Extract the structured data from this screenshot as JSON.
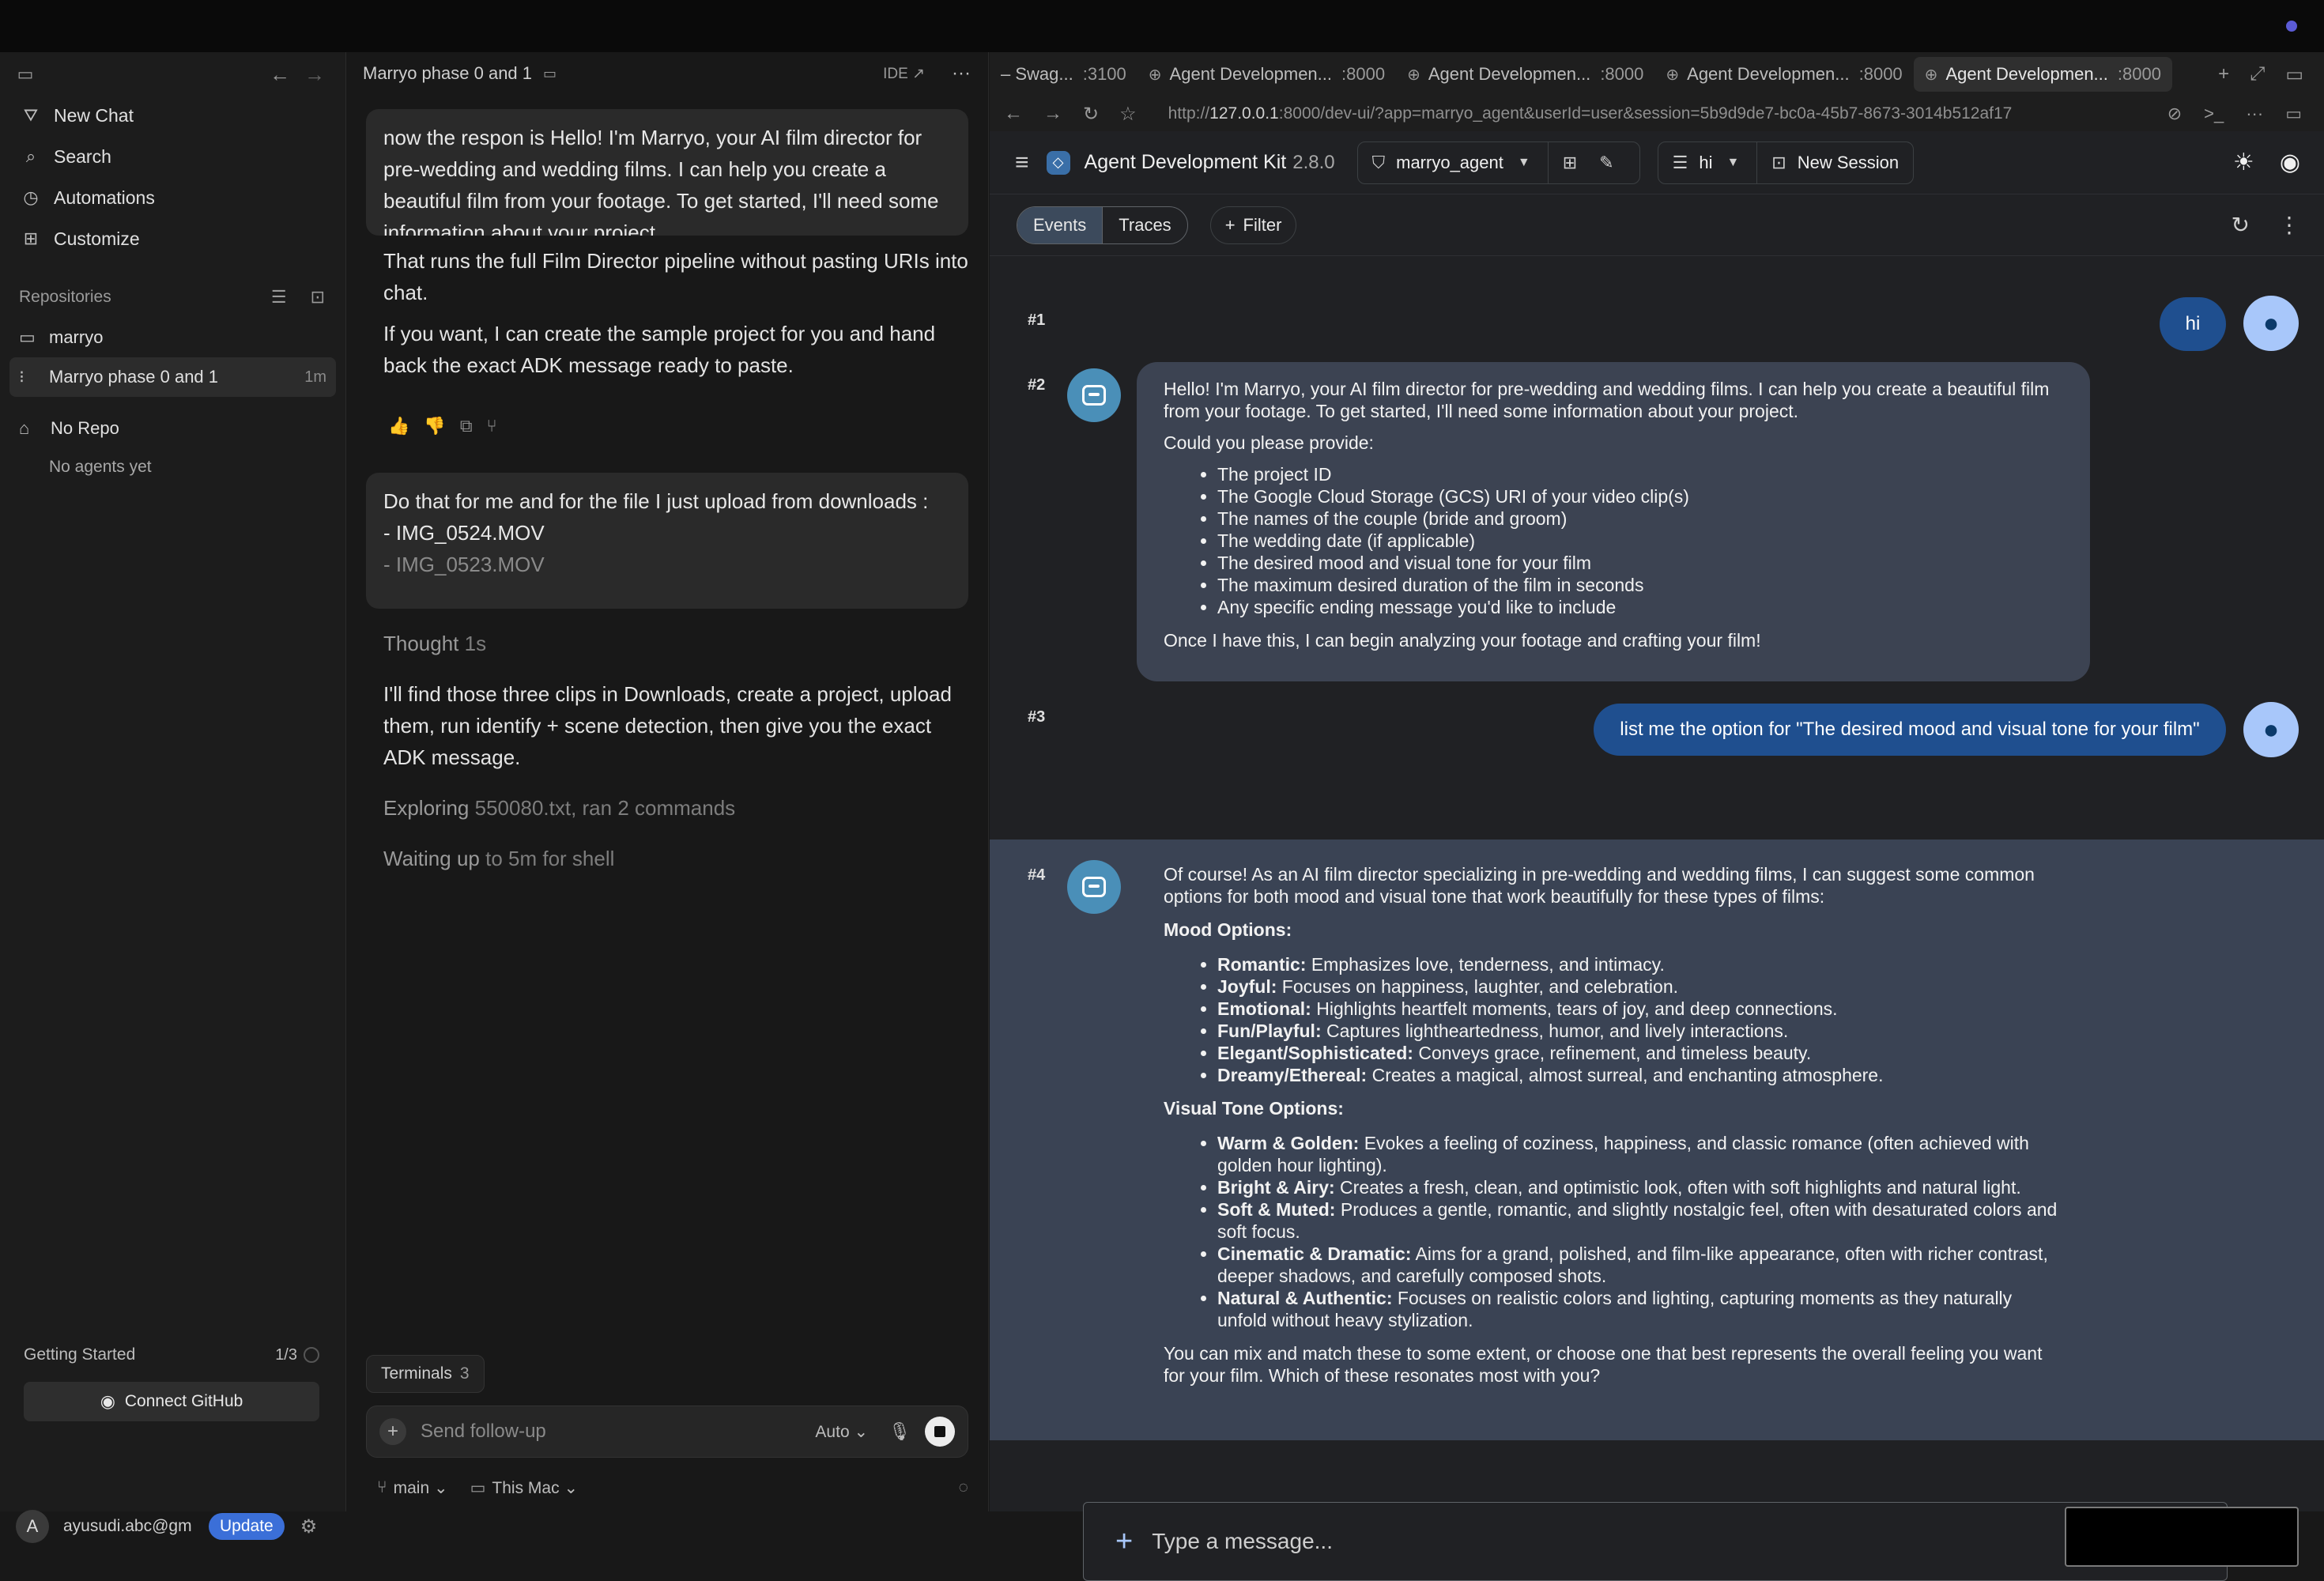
{
  "sidebar": {
    "nav": [
      {
        "label": "New Chat",
        "icon": "new-chat-icon"
      },
      {
        "label": "Search",
        "icon": "search-icon"
      },
      {
        "label": "Automations",
        "icon": "automations-icon"
      },
      {
        "label": "Customize",
        "icon": "customize-icon"
      }
    ],
    "repositories_label": "Repositories",
    "repos": [
      {
        "label": "marryo",
        "time": ""
      },
      {
        "label": "Marryo phase 0 and 1",
        "time": "1m"
      }
    ],
    "no_repo": "No Repo",
    "no_agents": "No agents yet",
    "getting_started": "Getting Started",
    "getting_started_count": "1/3",
    "connect_github": "Connect GitHub",
    "user_initial": "A",
    "user_email": "ayusudi.abc@gm",
    "update_label": "Update"
  },
  "chat": {
    "title": "Marryo phase 0 and 1",
    "ide_label": "IDE",
    "bubble1": "now the respon is Hello! I'm Marryo, your AI film director for pre-wedding and wedding films. I can help you create a beautiful film from your footage. To get started, I'll need some information about your project.",
    "para1": "That runs the full Film Director pipeline without pasting URIs into chat.",
    "para2": "If you want, I can create the sample project for you and hand back the exact ADK message ready to paste.",
    "bubble2_line1": "Do that for me and for the file I just upload from downloads :",
    "bubble2_line2": "- IMG_0524.MOV",
    "bubble2_line3": "- IMG_0523.MOV",
    "thought": "Thought",
    "thought_time": "1s",
    "para3": "I'll find those three clips in Downloads, create a project, upload them, run identify + scene detection, then give you the exact ADK message.",
    "exploring": "Exploring",
    "exploring_detail": "550080.txt, ran 2 commands",
    "waiting": "Waiting up",
    "waiting_detail": "to 5m for shell",
    "terminals_label": "Terminals",
    "terminals_count": "3",
    "composer_placeholder": "Send follow-up",
    "mode": "Auto",
    "branch": "main",
    "location": "This Mac"
  },
  "browser": {
    "tabs": [
      {
        "title": "– Swag...",
        "port": ":3100"
      },
      {
        "title": "Agent Developmen...",
        "port": ":8000"
      },
      {
        "title": "Agent Developmen...",
        "port": ":8000"
      },
      {
        "title": "Agent Developmen...",
        "port": ":8000"
      },
      {
        "title": "Agent Developmen...",
        "port": ":8000"
      }
    ],
    "url_prefix": "http://",
    "url_host": "127.0.0.1",
    "url_rest": ":8000/dev-ui/?app=marryo_agent&userId=user&session=5b9d9de7-bc0a-45b7-8673-3014b512af17"
  },
  "adk": {
    "title": "Agent Development Kit",
    "version": "2.8.0",
    "agent": "marryo_agent",
    "session_label": "hi",
    "new_session": "New Session",
    "tabs": [
      "Events",
      "Traces"
    ],
    "filter": "Filter",
    "events": {
      "e1": {
        "num": "#1",
        "text": "hi"
      },
      "e2": {
        "num": "#2",
        "intro": "Hello! I'm Marryo, your AI film director for pre-wedding and wedding films. I can help you create a beautiful film from your footage. To get started, I'll need some information about your project.",
        "ask": "Could you please provide:",
        "items": [
          "The project ID",
          "The Google Cloud Storage (GCS) URI of your video clip(s)",
          "The names of the couple (bride and groom)",
          "The wedding date (if applicable)",
          "The desired mood and visual tone for your film",
          "The maximum desired duration of the film in seconds",
          "Any specific ending message you'd like to include"
        ],
        "outro": "Once I have this, I can begin analyzing your footage and crafting your film!"
      },
      "e3": {
        "num": "#3",
        "text": "list me the option for \"The desired mood and visual tone for your film\""
      },
      "e4": {
        "num": "#4",
        "intro": "Of course! As an AI film director specializing in pre-wedding and wedding films, I can suggest some common options for both mood and visual tone that work beautifully for these types of films:",
        "mood_heading": "Mood Options:",
        "mood": [
          {
            "term": "Romantic:",
            "desc": "Emphasizes love, tenderness, and intimacy."
          },
          {
            "term": "Joyful:",
            "desc": "Focuses on happiness, laughter, and celebration."
          },
          {
            "term": "Emotional:",
            "desc": "Highlights heartfelt moments, tears of joy, and deep connections."
          },
          {
            "term": "Fun/Playful:",
            "desc": "Captures lightheartedness, humor, and lively interactions."
          },
          {
            "term": "Elegant/Sophisticated:",
            "desc": "Conveys grace, refinement, and timeless beauty."
          },
          {
            "term": "Dreamy/Ethereal:",
            "desc": "Creates a magical, almost surreal, and enchanting atmosphere."
          }
        ],
        "tone_heading": "Visual Tone Options:",
        "tone": [
          {
            "term": "Warm & Golden:",
            "desc": "Evokes a feeling of coziness, happiness, and classic romance (often achieved with golden hour lighting)."
          },
          {
            "term": "Bright & Airy:",
            "desc": "Creates a fresh, clean, and optimistic look, often with soft highlights and natural light."
          },
          {
            "term": "Soft & Muted:",
            "desc": "Produces a gentle, romantic, and slightly nostalgic feel, often with desaturated colors and soft focus."
          },
          {
            "term": "Cinematic & Dramatic:",
            "desc": "Aims for a grand, polished, and film-like appearance, often with richer contrast, deeper shadows, and carefully composed shots."
          },
          {
            "term": "Natural & Authentic:",
            "desc": "Focuses on realistic colors and lighting, capturing moments as they naturally unfold without heavy stylization."
          }
        ],
        "outro": "You can mix and match these to some extent, or choose one that best represents the overall feeling you want for your film. Which of these resonates most with you?"
      }
    },
    "input_placeholder": "Type a message..."
  }
}
